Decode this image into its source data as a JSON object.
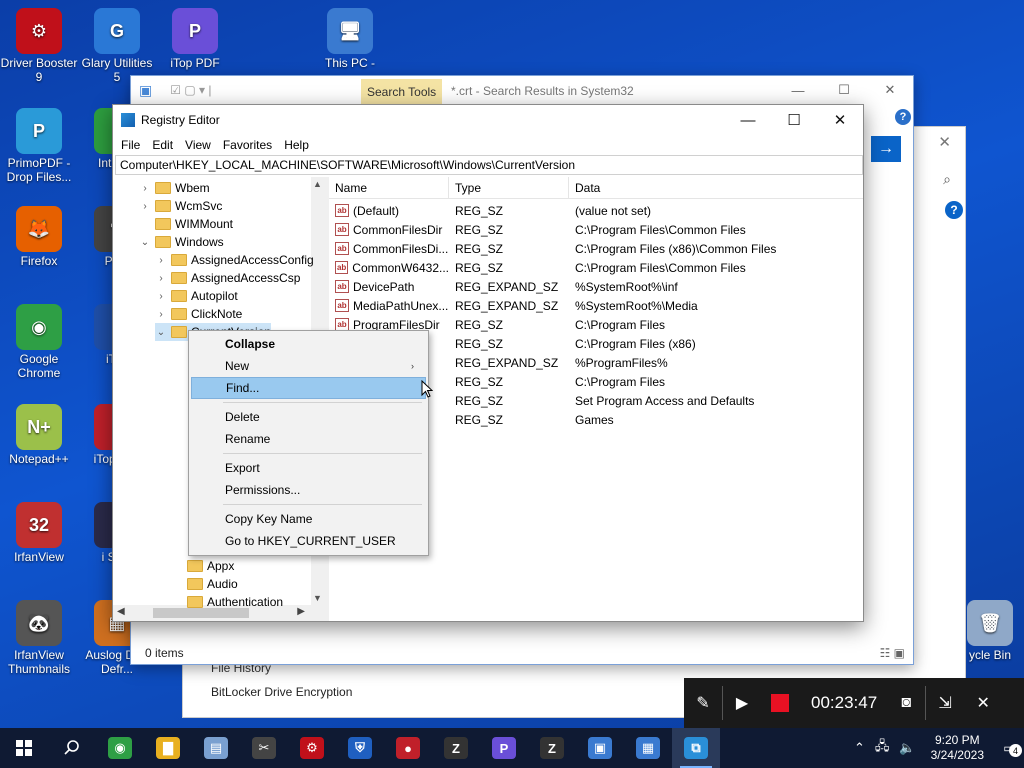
{
  "desktop": {
    "left_icons": [
      {
        "label": "Driver Booster 9",
        "icon": "driver-booster-icon",
        "color": "#c0101a",
        "glyph": "⚙"
      },
      {
        "label": "PrimoPDF - Drop Files...",
        "icon": "primopdf-icon",
        "color": "#2a9ad8",
        "glyph": "P"
      },
      {
        "label": "Firefox",
        "icon": "firefox-icon",
        "color": "#e66000",
        "glyph": "🦊"
      },
      {
        "label": "Google Chrome",
        "icon": "chrome-icon",
        "color": "#2e9f45",
        "glyph": "◉"
      },
      {
        "label": "Notepad++",
        "icon": "notepadpp-icon",
        "color": "#9bc04a",
        "glyph": "N+"
      },
      {
        "label": "IrfanView",
        "icon": "irfanview-icon",
        "color": "#c03030",
        "glyph": "32"
      },
      {
        "label": "IrfanView Thumbnails",
        "icon": "irfanview-thumbnails-icon",
        "color": "#555",
        "glyph": "🐼"
      }
    ],
    "second_col_icons": [
      {
        "label": "Glary Utilities 5",
        "icon": "glary-utilities-icon",
        "color": "#2a78d6",
        "glyph": "G"
      },
      {
        "label": "Int Dov",
        "icon": "internet-download-icon",
        "color": "#2d9d3f",
        "glyph": "↓"
      },
      {
        "label": "Phot",
        "icon": "photo-icon",
        "color": "#444",
        "glyph": "✎"
      },
      {
        "label": "iTop",
        "icon": "itop-icon",
        "color": "#1f4fa8",
        "glyph": "i"
      },
      {
        "label": "iTop Rec",
        "icon": "itop-recorder-icon",
        "color": "#c0202a",
        "glyph": "●"
      },
      {
        "label": "i Scre",
        "icon": "itop-screenshot-icon",
        "color": "#2a2a4a",
        "glyph": "i"
      },
      {
        "label": "Auslog Disk Defr...",
        "icon": "auslogics-defrag-icon",
        "color": "#d07020",
        "glyph": "▦"
      }
    ],
    "top_icons": [
      {
        "label": "iTop PDF",
        "icon": "itop-pdf-icon",
        "color": "#6a4fd8",
        "glyph": "P"
      },
      {
        "label": "This PC -",
        "icon": "this-pc-icon",
        "color": "#3a7ad0",
        "glyph": "🖥"
      }
    ],
    "recycle_label": "ycle Bin"
  },
  "explorer": {
    "search_tools_label": "Search Tools",
    "title": "*.crt - Search Results in System32",
    "status": "0 items",
    "settings_items": [
      "File History",
      "BitLocker Drive Encryption"
    ]
  },
  "regedit": {
    "title": "Registry Editor",
    "menu": [
      "File",
      "Edit",
      "View",
      "Favorites",
      "Help"
    ],
    "address": "Computer\\HKEY_LOCAL_MACHINE\\SOFTWARE\\Microsoft\\Windows\\CurrentVersion",
    "tree": [
      {
        "label": "Wbem",
        "indent": 0,
        "exp": "›"
      },
      {
        "label": "WcmSvc",
        "indent": 0,
        "exp": "›"
      },
      {
        "label": "WIMMount",
        "indent": 0,
        "exp": ""
      },
      {
        "label": "Windows",
        "indent": 0,
        "exp": "⌄"
      },
      {
        "label": "AssignedAccessConfig",
        "indent": 1,
        "exp": "›"
      },
      {
        "label": "AssignedAccessCsp",
        "indent": 1,
        "exp": "›"
      },
      {
        "label": "Autopilot",
        "indent": 1,
        "exp": "›"
      },
      {
        "label": "ClickNote",
        "indent": 1,
        "exp": "›"
      },
      {
        "label": "CurrentVersion",
        "indent": 1,
        "exp": "⌄",
        "selected": true
      },
      {
        "label": "Appx",
        "indent": 2,
        "exp": ""
      },
      {
        "label": "Audio",
        "indent": 2,
        "exp": ""
      },
      {
        "label": "Authentication",
        "indent": 2,
        "exp": ""
      }
    ],
    "columns": [
      "Name",
      "Type",
      "Data"
    ],
    "values": [
      {
        "name": "(Default)",
        "type": "REG_SZ",
        "data": "(value not set)"
      },
      {
        "name": "CommonFilesDir",
        "type": "REG_SZ",
        "data": "C:\\Program Files\\Common Files"
      },
      {
        "name": "CommonFilesDi...",
        "type": "REG_SZ",
        "data": "C:\\Program Files (x86)\\Common Files"
      },
      {
        "name": "CommonW6432...",
        "type": "REG_SZ",
        "data": "C:\\Program Files\\Common Files"
      },
      {
        "name": "DevicePath",
        "type": "REG_EXPAND_SZ",
        "data": "%SystemRoot%\\inf"
      },
      {
        "name": "MediaPathUnex...",
        "type": "REG_EXPAND_SZ",
        "data": "%SystemRoot%\\Media"
      },
      {
        "name": "ProgramFilesDir",
        "type": "REG_SZ",
        "data": "C:\\Program Files"
      },
      {
        "name": "Dir ...",
        "type": "REG_SZ",
        "data": "C:\\Program Files (x86)"
      },
      {
        "name": "Path",
        "type": "REG_EXPAND_SZ",
        "data": "%ProgramFiles%"
      },
      {
        "name": "2Dir",
        "type": "REG_SZ",
        "data": "C:\\Program Files"
      },
      {
        "name": "Pr...",
        "type": "REG_SZ",
        "data": "Set Program Access and Defaults"
      },
      {
        "name": "me",
        "type": "REG_SZ",
        "data": "Games"
      }
    ]
  },
  "context_menu": {
    "items": [
      {
        "label": "Collapse",
        "bold": true
      },
      {
        "label": "New",
        "submenu": true
      },
      {
        "label": "Find...",
        "highlighted": true
      },
      {
        "sep": true
      },
      {
        "label": "Delete"
      },
      {
        "label": "Rename"
      },
      {
        "sep": true
      },
      {
        "label": "Export"
      },
      {
        "label": "Permissions..."
      },
      {
        "sep": true
      },
      {
        "label": "Copy Key Name"
      },
      {
        "label": "Go to HKEY_CURRENT_USER"
      }
    ]
  },
  "recorder": {
    "timer": "00:23:47"
  },
  "taskbar": {
    "apps": [
      {
        "icon": "chrome-icon",
        "color": "#2e9f45",
        "glyph": "◉"
      },
      {
        "icon": "file-explorer-icon",
        "color": "#e8b020",
        "glyph": "▇"
      },
      {
        "icon": "notepad-icon",
        "color": "#7aa0d0",
        "glyph": "▤"
      },
      {
        "icon": "snip-icon",
        "color": "#444",
        "glyph": "✂"
      },
      {
        "icon": "driver-booster-icon",
        "color": "#c0101a",
        "glyph": "⚙"
      },
      {
        "icon": "shield-icon",
        "color": "#1f5fc0",
        "glyph": "⛨"
      },
      {
        "icon": "itop-recorder-icon",
        "color": "#c0202a",
        "glyph": "●"
      },
      {
        "icon": "z-app-icon",
        "color": "#333",
        "glyph": "Z"
      },
      {
        "icon": "itop-pdf-icon",
        "color": "#6a4fd8",
        "glyph": "P"
      },
      {
        "icon": "zip-icon",
        "color": "#333",
        "glyph": "Z"
      },
      {
        "icon": "control-panel-icon",
        "color": "#3a7ad0",
        "glyph": "▣"
      },
      {
        "icon": "system-info-icon",
        "color": "#3a7ad0",
        "glyph": "▦"
      },
      {
        "icon": "regedit-icon",
        "color": "#2a8fd8",
        "glyph": "⧉",
        "active": true
      }
    ],
    "time": "9:20 PM",
    "date": "3/24/2023",
    "notification_count": "4"
  }
}
